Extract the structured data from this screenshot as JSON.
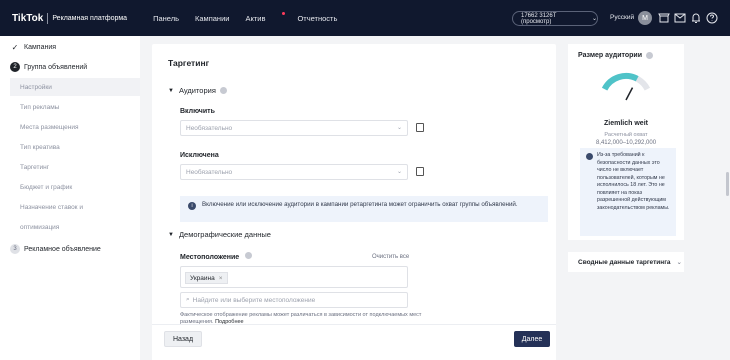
{
  "topbar": {
    "logo": "TikTok",
    "platform": "Рекламная платформа",
    "nav": [
      "Панель",
      "Кампании",
      "Актив",
      "Отчетность"
    ],
    "account": "17662 3126T (просмотр)",
    "language": "Русский",
    "avatar_letter": "M"
  },
  "sidebar": {
    "steps": [
      {
        "label": "Кампания",
        "state": "done"
      },
      {
        "label": "Группа объявлений",
        "state": "current",
        "number": "2"
      },
      {
        "label": "Рекламное объявление",
        "state": "pending",
        "number": "3"
      }
    ],
    "subitems": [
      "Настройки",
      "Тип рекламы",
      "Места размещения",
      "Тип креатива",
      "Таргетинг",
      "Бюджет и график",
      "Назначение ставок и",
      "оптимизация"
    ]
  },
  "main": {
    "title": "Таргетинг",
    "audience_section": "Аудитория",
    "include_label": "Включить",
    "include_placeholder": "Необязательно",
    "exclude_label": "Исключена",
    "exclude_placeholder": "Необязательно",
    "notice": "Включение или исключение аудитории в кампании ретаргетинга может ограничить охват группы объявлений.",
    "demographics_section": "Демографические данные",
    "location_label": "Местоположение",
    "clear_all": "Очистить все",
    "location_tag": "Украина",
    "search_placeholder": "Найдите или выберите местоположение",
    "fine_print": "Фактическое отображение рекламы может различаться в зависимости от подключаемых мест размещения.",
    "fine_link": "Подробнее"
  },
  "footer": {
    "back": "Назад",
    "next": "Далее"
  },
  "right_panel": {
    "title": "Размер аудитории",
    "status": "Ziemlich weit",
    "reach_label": "Расчетный охват",
    "reach_value": "8,412,000–10,292,000",
    "note": "Из-за требований к безопасности данных это число не включает пользователей, которым не исполнилось 18 лет. Это не повлияет на показ разрешенной действующим законодательством рекламы.",
    "summary": "Сводные данные таргетинга",
    "gauge_level": 0.72
  },
  "colors": {
    "topbar": "#10182e",
    "accent": "#243157",
    "gauge_arc": "#4fc3c8"
  }
}
